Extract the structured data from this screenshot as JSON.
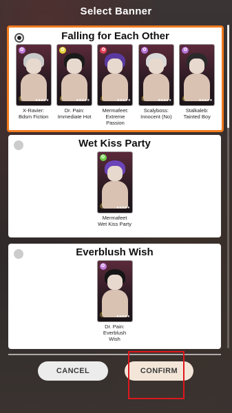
{
  "header": {
    "title": "Select Banner"
  },
  "banners": [
    {
      "name": "Falling for Each Other",
      "selected": true,
      "characters": [
        {
          "line1": "X-Ravier:",
          "line2": "Bdsm Fiction",
          "badge_color": "#c07ad8",
          "hair_color": "#c9c9c9"
        },
        {
          "line1": "Dr. Pain:",
          "line2": "Immediate Hot",
          "badge_color": "#e5d43a",
          "hair_color": "#1b1b1b"
        },
        {
          "line1": "Mermafeet:",
          "line2": "Extreme Passion",
          "badge_color": "#e0405a",
          "hair_color": "#5a3aa0"
        },
        {
          "line1": "Scalyboss:",
          "line2": "Innocent (No)",
          "badge_color": "#b672d6",
          "hair_color": "#d8d8d8"
        },
        {
          "line1": "Stalkaleb:",
          "line2": "Tainted Boy",
          "badge_color": "#b672d6",
          "hair_color": "#2a2a2a"
        }
      ]
    },
    {
      "name": "Wet Kiss Party",
      "selected": false,
      "characters": [
        {
          "line1": "Mermafeet",
          "line2": "Wet Kiss Party",
          "badge_color": "#6fd04a",
          "hair_color": "#6a44b8"
        }
      ]
    },
    {
      "name": "Everblush Wish",
      "selected": false,
      "characters": [
        {
          "line1": "Dr. Pain:",
          "line2": "Everblush Wish",
          "badge_color": "#c07ad8",
          "hair_color": "#151515"
        }
      ]
    }
  ],
  "buttons": {
    "cancel": "CANCEL",
    "confirm": "CONFIRM"
  },
  "colors": {
    "selected_border": "#f07a1e",
    "highlight": "#e0161d",
    "moon": "#f5d442"
  },
  "icons": {
    "rarity": "moon-icon",
    "stars": "stars-icon"
  },
  "glyphs": {
    "moon": "☾",
    "stars": "★★★★★",
    "badge": "✿"
  }
}
